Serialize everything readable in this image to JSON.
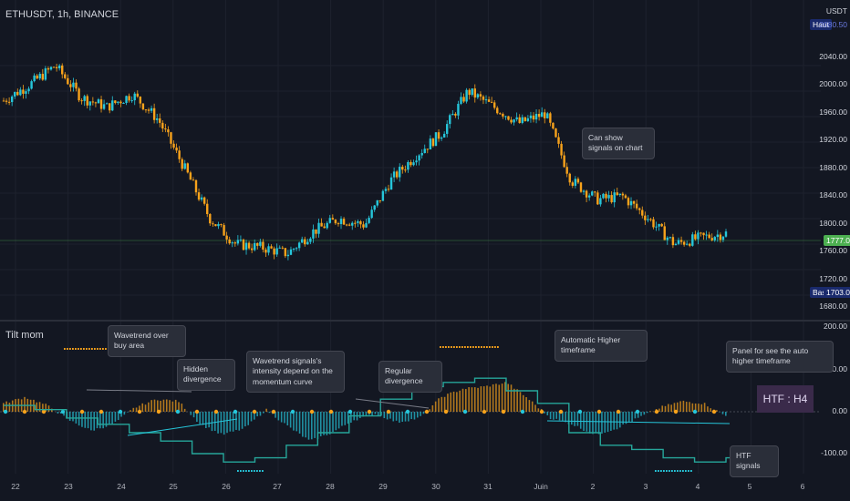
{
  "header": {
    "symbol": "ETHUSDT, 1h, BINANCE",
    "currency": "USDT"
  },
  "indicator": {
    "title": "Tilt mom"
  },
  "price_axis": {
    "ticks": [
      "2040.00",
      "2000.00",
      "1960.00",
      "1920.00",
      "1880.00",
      "1840.00",
      "1800.00",
      "1760.00",
      "1720.00",
      "1680.00"
    ],
    "high_label": "Haut",
    "low_label": "Bas",
    "current_price": "1777.05",
    "low_price": "1703.00",
    "high_price": "2080.50"
  },
  "osc_axis": {
    "ticks": [
      "200.00",
      "100.00",
      "0.00",
      "-100.00"
    ]
  },
  "x_axis": {
    "ticks": [
      "22",
      "23",
      "24",
      "25",
      "26",
      "27",
      "28",
      "29",
      "30",
      "31",
      "Juin",
      "2",
      "3",
      "4",
      "5",
      "6"
    ]
  },
  "annotations": {
    "chart_signals": "Can show signals on chart",
    "wavetrend_buy": "Wavetrend over buy area",
    "hidden_div": "Hidden divergence",
    "intensity": "Wavetrend signals's intensity depend on the momentum curve",
    "regular_div": "Regular divergence",
    "auto_htf": "Automatic Higher timeframe",
    "panel_htf": "Panel for see the auto higher timeframe",
    "htf_signals": "HTF signals"
  },
  "htf_panel": {
    "label": "HTF : H4"
  },
  "colors": {
    "bull": "#26c6da",
    "bear": "#f7a21b",
    "background": "#131722",
    "htf_line": "#f7a21b",
    "htf_line_alt": "#26a69a"
  },
  "chart_data": [
    {
      "type": "candlestick",
      "title": "ETHUSDT, 1h, BINANCE",
      "x": [
        "22",
        "23",
        "24",
        "25",
        "26",
        "27",
        "28",
        "29",
        "30",
        "31",
        "Juin",
        "2",
        "3",
        "4"
      ],
      "close_path": [
        1985,
        2010,
        2040,
        1990,
        1975,
        1995,
        1955,
        1880,
        1800,
        1760,
        1755,
        1745,
        1780,
        1800,
        1790,
        1860,
        1900,
        1935,
        2000,
        1975,
        1950,
        1965,
        1860,
        1830,
        1835,
        1800,
        1760,
        1770,
        1777
      ],
      "ylim": [
        1660,
        2100
      ],
      "current_price": 1777.05
    },
    {
      "type": "bar",
      "title": "Tilt mom",
      "ylim": [
        -150,
        200
      ],
      "histogram": [
        20,
        35,
        15,
        -20,
        -45,
        -30,
        10,
        30,
        25,
        -30,
        -55,
        -40,
        5,
        -35,
        -70,
        -50,
        -20,
        -5,
        -25,
        -15,
        35,
        55,
        60,
        70,
        30,
        -15,
        -30,
        -55,
        -40,
        -15,
        10,
        25,
        20,
        -10
      ],
      "htf_line": [
        15,
        5,
        -15,
        -30,
        -50,
        -70,
        -100,
        -120,
        -110,
        -80,
        -50,
        -10,
        30,
        60,
        70,
        80,
        50,
        20,
        -50,
        -80,
        -90,
        -110,
        -120,
        -110
      ]
    }
  ]
}
